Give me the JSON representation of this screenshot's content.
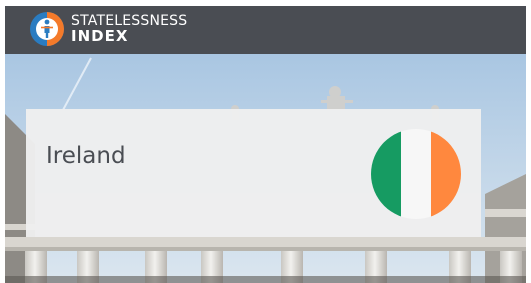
{
  "brand": {
    "line1": "STATELESSNESS",
    "line2": "INDEX",
    "icon": "stateless-figure-icon",
    "colors": {
      "orange": "#f47a2a",
      "blue": "#2a7cc1",
      "bar": "#4a4d53"
    }
  },
  "card": {
    "country": "Ireland",
    "flag_icon": "ireland-flag-icon",
    "flag_colors": [
      "#169b62",
      "#f7f7f7",
      "#ff883e"
    ]
  },
  "hero": {
    "image": "building-columns-photo"
  }
}
